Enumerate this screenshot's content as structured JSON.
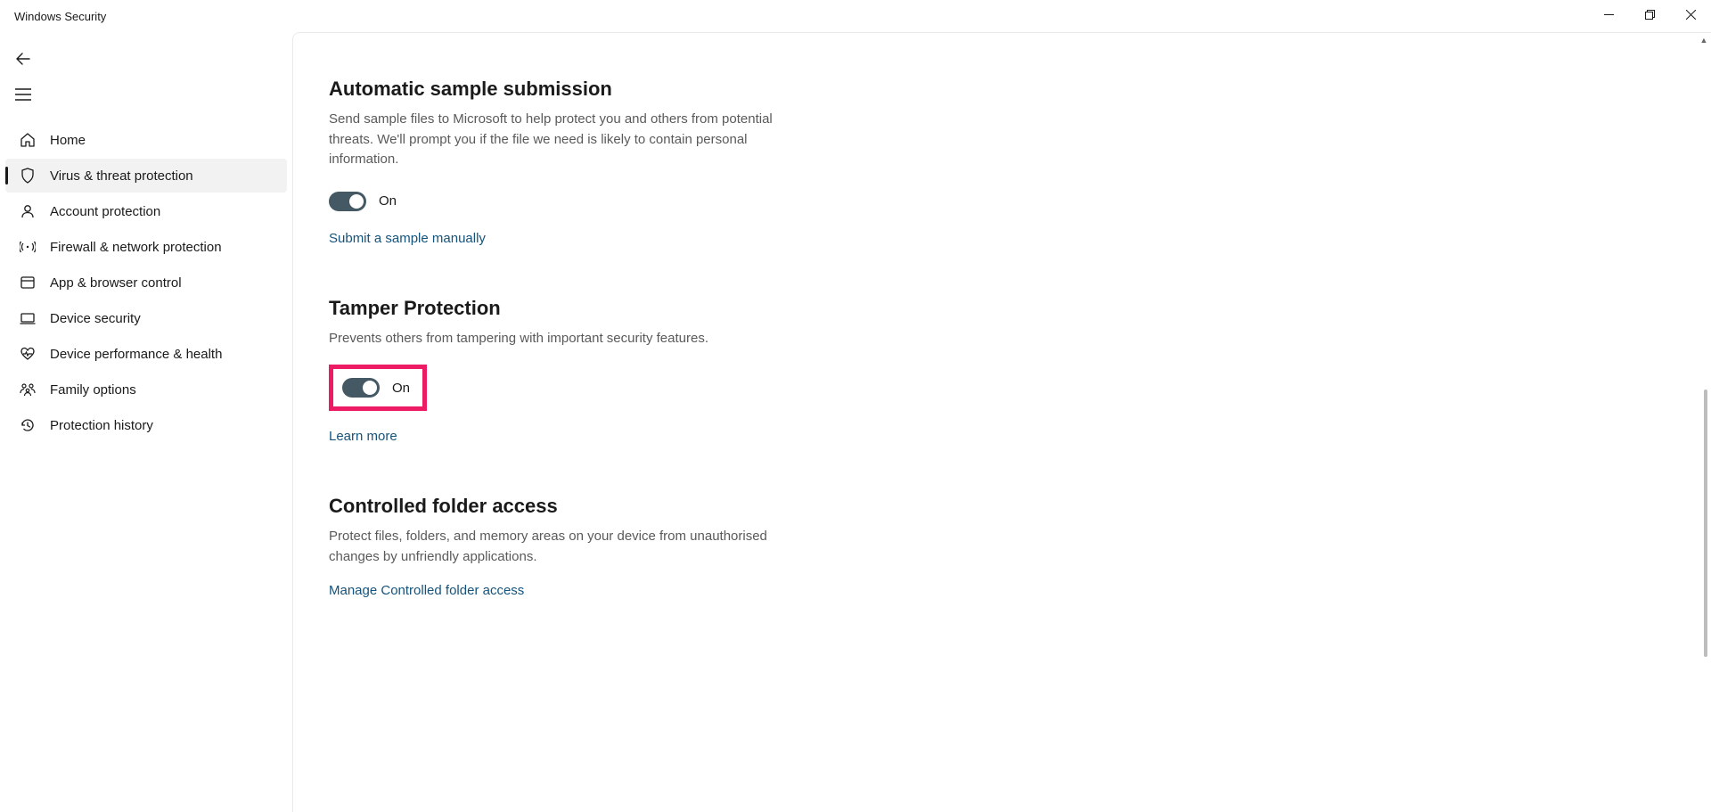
{
  "window": {
    "title": "Windows Security"
  },
  "nav": {
    "items": [
      {
        "label": "Home"
      },
      {
        "label": "Virus & threat protection"
      },
      {
        "label": "Account protection"
      },
      {
        "label": "Firewall & network protection"
      },
      {
        "label": "App & browser control"
      },
      {
        "label": "Device security"
      },
      {
        "label": "Device performance & health"
      },
      {
        "label": "Family options"
      },
      {
        "label": "Protection history"
      }
    ]
  },
  "sections": {
    "auto_sample": {
      "title": "Automatic sample submission",
      "desc": "Send sample files to Microsoft to help protect you and others from potential threats. We'll prompt you if the file we need is likely to contain personal information.",
      "toggle_state": "On",
      "link": "Submit a sample manually"
    },
    "tamper": {
      "title": "Tamper Protection",
      "desc": "Prevents others from tampering with important security features.",
      "toggle_state": "On",
      "link": "Learn more"
    },
    "controlled_folder": {
      "title": "Controlled folder access",
      "desc": "Protect files, folders, and memory areas on your device from unauthorised changes by unfriendly applications.",
      "link": "Manage Controlled folder access"
    }
  }
}
